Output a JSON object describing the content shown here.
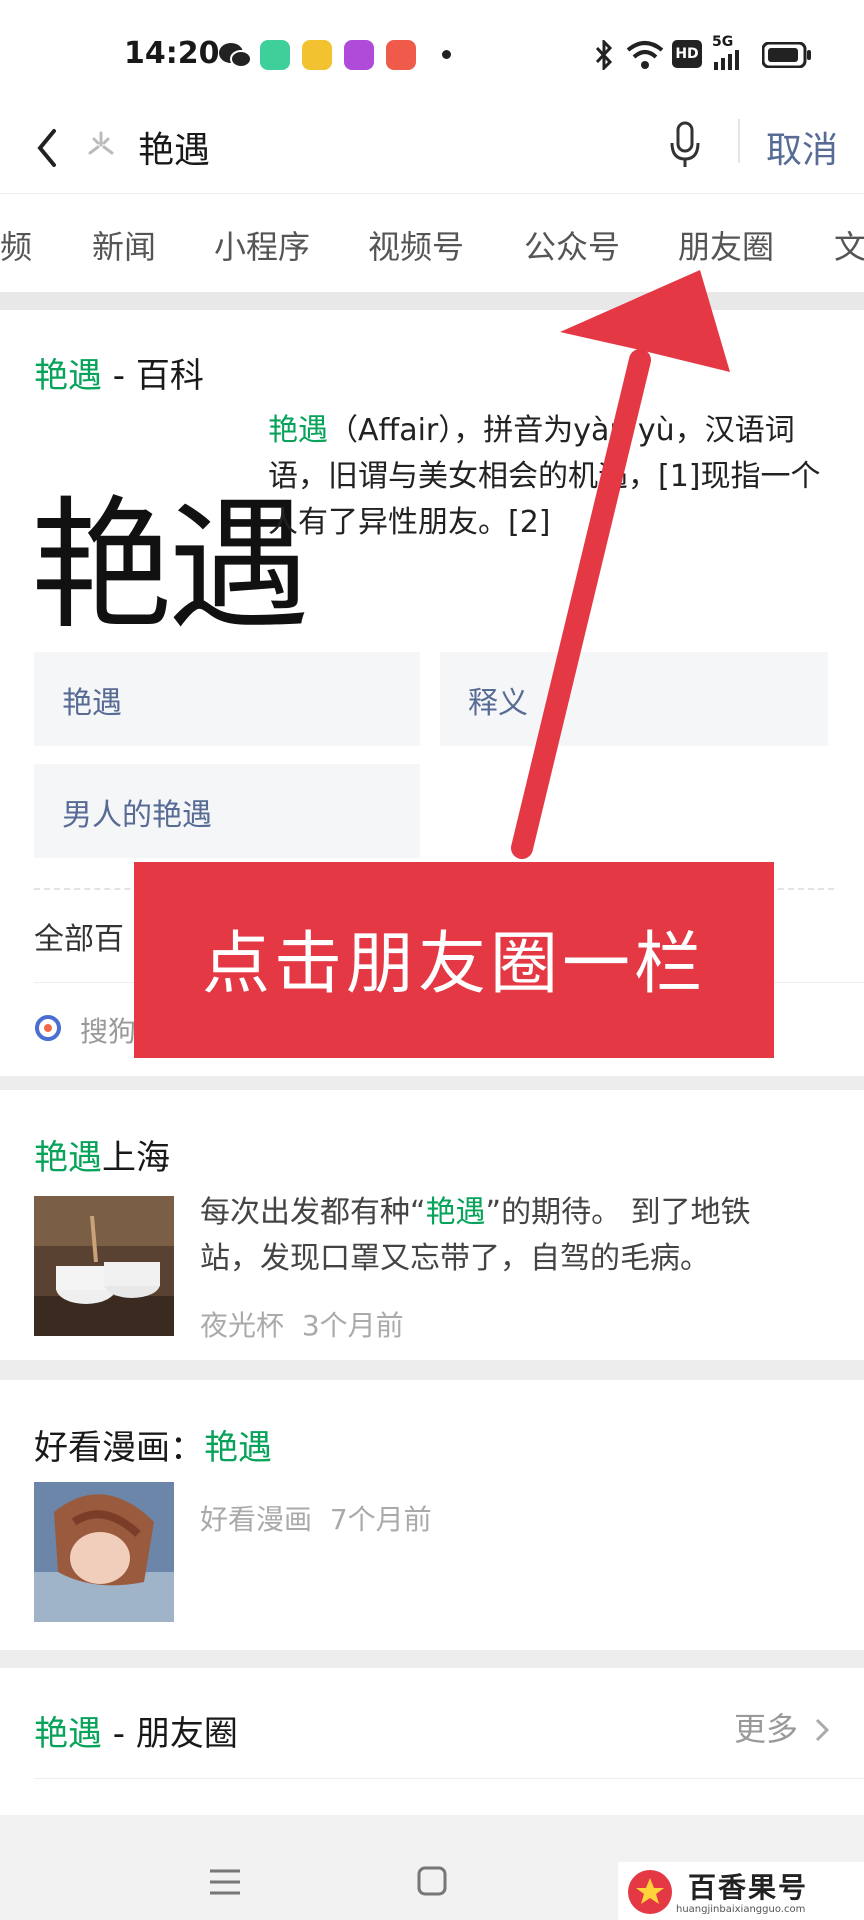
{
  "status_bar": {
    "time": "14:20",
    "icons": [
      "wechat-icon",
      "app-green-icon",
      "app-yellow-icon",
      "app-purple-icon",
      "app-red-icon",
      "bluetooth-icon",
      "wifi-icon",
      "hd-icon",
      "signal-5g-icon",
      "battery-icon"
    ],
    "hd_label": "HD",
    "net_label": "5G"
  },
  "search": {
    "query": "艳遇",
    "cancel": "取消"
  },
  "tabs": [
    "频",
    "新闻",
    "小程序",
    "视频号",
    "公众号",
    "朋友圈",
    "文"
  ],
  "baike": {
    "title_keyword": "艳遇",
    "title_rest": " - 百科",
    "big_char": "艳遇",
    "desc_keyword": "艳遇",
    "desc_rest": "（Affair），拼音为yàn yù，汉语词语，旧谓与美女相会的机遇，[1]现指一个人有了异性朋友。[2]",
    "tiles": [
      "艳遇",
      "释义",
      "男人的艳遇"
    ],
    "all_label": "全部百",
    "source": "搜狗"
  },
  "article1": {
    "title_keyword": "艳遇",
    "title_rest": "上海",
    "text_pre": "每次出发都有种“",
    "text_keyword": "艳遇",
    "text_post": "”的期待。 到了地铁站，发现口罩又忘带了，自驾的毛病。",
    "author": "夜光杯",
    "time": "3个月前"
  },
  "article2": {
    "title_pre": "好看漫画：",
    "title_keyword": "艳遇",
    "author": "好看漫画",
    "time": "7个月前"
  },
  "moments": {
    "title_keyword": "艳遇",
    "title_rest": " - 朋友圈",
    "more": "更多"
  },
  "annotation": {
    "text": "点击朋友圈一栏"
  },
  "watermark": {
    "brand": "百香果号",
    "url": "huangjinbaixiangguo.com"
  },
  "colors": {
    "accent_green": "#07a35a",
    "link_blue": "#576b95",
    "annotation_red": "#e43844"
  }
}
